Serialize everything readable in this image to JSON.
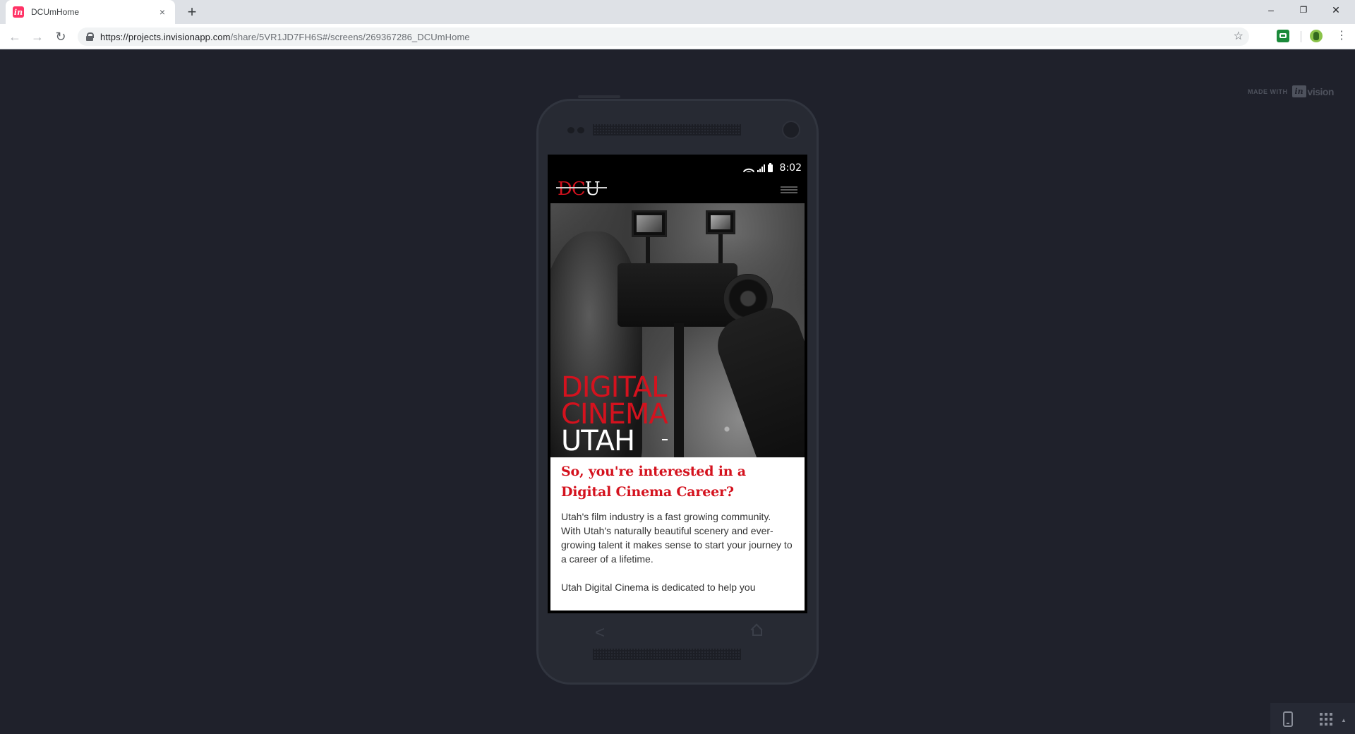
{
  "browser": {
    "tab_title": "DCUmHome",
    "tab_close": "×",
    "new_tab": "+",
    "url_host": "https://projects.invisionapp.com",
    "url_path": "/share/5VR1JD7FH6S#/screens/269367286_DCUmHome",
    "window_controls": {
      "minimize": "–",
      "restore": "❐",
      "close": "✕"
    },
    "nav": {
      "back": "←",
      "forward": "→",
      "reload": "↻"
    },
    "star": "☆",
    "menu": "⋮"
  },
  "invision": {
    "made_with": "MADE WITH",
    "logo_box": "in",
    "logo_word": "vision"
  },
  "phone": {
    "status_time": "8:02",
    "logo": {
      "red": "DC",
      "white": "U"
    },
    "hero": {
      "line1": "DIGITAL",
      "line2": "CINEMA",
      "line3": "UTAH"
    },
    "headline": "So, you're interested in a Digital Cinema Career?",
    "paragraph1": "Utah's film industry is a fast growing community. With Utah's naturally beautiful scenery and ever-growing talent it makes sense to start your journey to a career of a lifetime.",
    "paragraph2": "Utah Digital Cinema is dedicated to help you",
    "hw_back": "<"
  },
  "colors": {
    "brand_red": "#d4121e",
    "canvas_bg": "#1f212b",
    "invision_pink": "#ff3366"
  },
  "icons": [
    "invision-favicon-icon",
    "close-icon",
    "plus-icon",
    "back-arrow-icon",
    "forward-arrow-icon",
    "reload-icon",
    "lock-icon",
    "star-icon",
    "extension-icon",
    "profile-icon",
    "kebab-menu-icon",
    "wifi-icon",
    "signal-icon",
    "battery-icon",
    "hamburger-menu-icon",
    "phone-view-icon",
    "grid-view-icon"
  ]
}
